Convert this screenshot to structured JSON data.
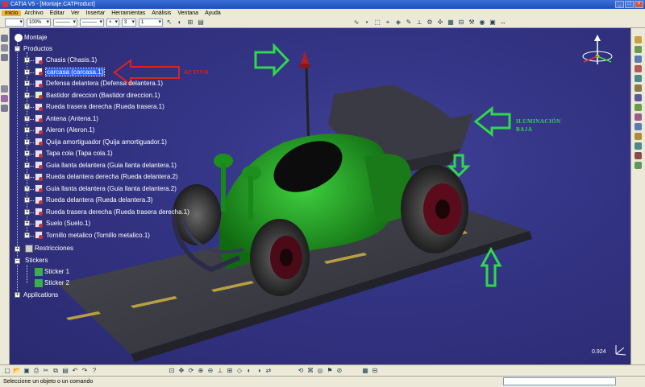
{
  "window": {
    "title": "CATIA V5 - [Montaje.CATProduct]"
  },
  "menu": {
    "items": [
      "Inicio",
      "Archivo",
      "Editar",
      "Ver",
      "Insertar",
      "Herramientas",
      "Análisis",
      "Ventana",
      "Ayuda"
    ]
  },
  "toolbar": {
    "zoom_value": "100%",
    "layer_value": "3",
    "level_value": "1"
  },
  "tree": {
    "root": "Montaje",
    "productos_label": "Productos",
    "productos": [
      "Chasis (Chasis.1)",
      "carcasa (carcasa.1)",
      "Defensa delantera (Defensa delantera.1)",
      "Bastidor direccion (Bastidor direccion.1)",
      "Rueda trasera derecha (Rueda trasera.1)",
      "Antena (Antena.1)",
      "Aleron (Aleron.1)",
      "Quija amortiguador (Quija amortiguador.1)",
      "Tapa cola (Tapa cola.1)",
      "Guia llanta delantera (Guia llanta delantera.1)",
      "Rueda delantera derecha (Rueda delantera.2)",
      "Guia llanta delantera (Guia llanta delantera.2)",
      "Rueda delantera (Rueda delantera.3)",
      "Rueda trasera derecha (Rueda trasera derecha.1)",
      "Suelo (Suelo.1)",
      "Tornillo metalico (Tornillo metalico.1)"
    ],
    "restricciones_label": "Restricciones",
    "stickers_label": "Stickers",
    "stickers": [
      "Sticker 1",
      "Sticker 2"
    ],
    "applications_label": "Applications"
  },
  "annotations": {
    "activo": "ACTIVO",
    "iluminacion_1": "ILUMINACIÓN",
    "iluminacion_2": "BAJA"
  },
  "viewport": {
    "zoom_readout": "0.924"
  },
  "status": {
    "message": "Seleccione un objeto o un comando"
  },
  "colors": {
    "body_green": "#1f8f1f",
    "background": "#33337f",
    "arrow_green": "#2fd94a",
    "arrow_red": "#e02020"
  }
}
